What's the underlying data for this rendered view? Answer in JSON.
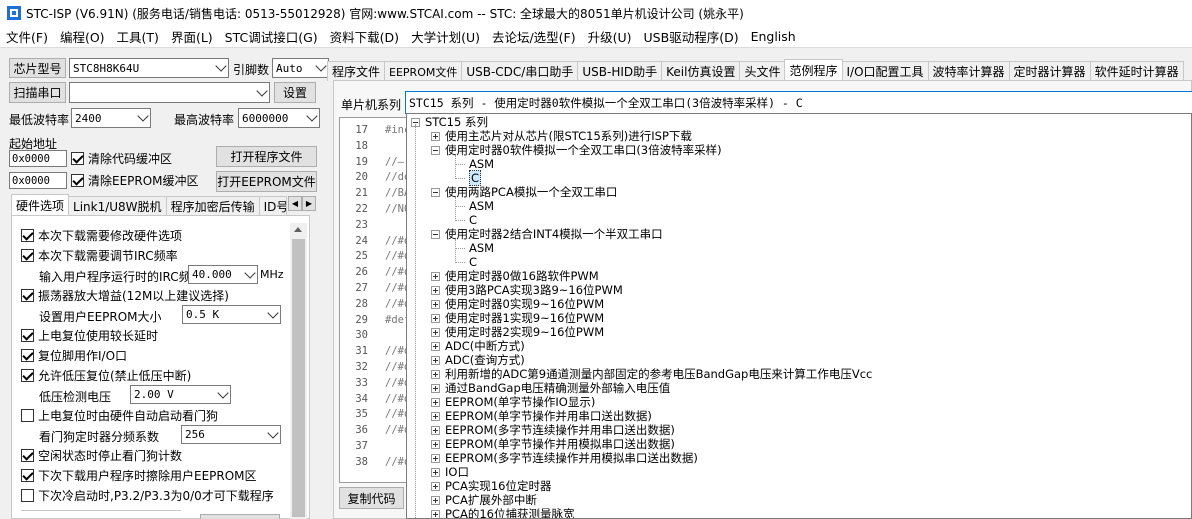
{
  "title": "STC-ISP (V6.91N) (服务电话/销售电话: 0513-55012928) 官网:www.STCAI.com  -- STC: 全球最大的8051单片机设计公司 (姚永平)",
  "menu": [
    "文件(F)",
    "编程(O)",
    "工具(T)",
    "界面(L)",
    "STC调试接口(G)",
    "资料下载(D)",
    "大学计划(U)",
    "去论坛/选型(F)",
    "升级(U)",
    "USB驱动程序(D)",
    "English"
  ],
  "left": {
    "chip_label": "芯片型号",
    "chip_value": "STC8H8K64U",
    "pins_label": "引脚数",
    "pins_value": "Auto",
    "scan_button": "扫描串口",
    "port_value": "",
    "settings_button": "设置",
    "min_baud_label": "最低波特率",
    "min_baud_value": "2400",
    "max_baud_label": "最高波特率",
    "max_baud_value": "6000000",
    "start_addr_label": "起始地址",
    "addr1": "0x0000",
    "clear_code": "清除代码缓冲区",
    "open_prog": "打开程序文件",
    "addr2": "0x0000",
    "clear_eeprom": "清除EEPROM缓冲区",
    "open_eeprom": "打开EEPROM文件",
    "tabs": [
      "硬件选项",
      "Link1/U8W脱机",
      "程序加密后传输",
      "ID号"
    ],
    "options": {
      "o1": "本次下载需要修改硬件选项",
      "o2": "本次下载需要调节IRC频率",
      "irc_label": "输入用户程序运行时的IRC频率",
      "irc_value": "40.000",
      "irc_unit": "MHz",
      "o3": "振荡器放大增益(12M以上建议选择)",
      "eeprom_label": "设置用户EEPROM大小",
      "eeprom_value": "0.5 K",
      "o4": "上电复位使用较长延时",
      "o5": "复位脚用作I/O口",
      "o6": "允许低压复位(禁止低压中断)",
      "lv_label": "低压检测电压",
      "lv_value": "2.00 V",
      "o7": "上电复位时由硬件自动启动看门狗",
      "wdt_label": "看门狗定时器分频系数",
      "wdt_value": "256",
      "o8": "空闲状态时停止看门狗计数",
      "o9": "下次下载用户程序时擦除用户EEPROM区",
      "o10": "下次冷启动时,P3.2/P3.3为0/0才可下载程序"
    }
  },
  "right": {
    "tabs": [
      "程序文件",
      "EEPROM文件",
      "USB-CDC/串口助手",
      "USB-HID助手",
      "Keil仿真设置",
      "头文件",
      "范例程序",
      "I/O口配置工具",
      "波特率计算器",
      "定时器计算器",
      "软件延时计算器"
    ],
    "series_label": "单片机系列",
    "series_value": "STC15 系列 - 使用定时器0软件模拟一个全双工串口(3倍波特率采样) - C",
    "copy_button": "复制代码",
    "code_lines": [
      {
        "n": "17",
        "t": "#inc"
      },
      {
        "n": "18",
        "t": ""
      },
      {
        "n": "19",
        "t": "//—"
      },
      {
        "n": "20",
        "t": "//de"
      },
      {
        "n": "21",
        "t": "//BA"
      },
      {
        "n": "22",
        "t": "//NO"
      },
      {
        "n": "23",
        "t": ""
      },
      {
        "n": "24",
        "t": "//#d"
      },
      {
        "n": "25",
        "t": "//#d"
      },
      {
        "n": "26",
        "t": "//#d"
      },
      {
        "n": "27",
        "t": "//#d"
      },
      {
        "n": "28",
        "t": "//#d"
      },
      {
        "n": "29",
        "t": "#def"
      },
      {
        "n": "30",
        "t": ""
      },
      {
        "n": "31",
        "t": "//#d"
      },
      {
        "n": "32",
        "t": "//#d"
      },
      {
        "n": "33",
        "t": "//#d"
      },
      {
        "n": "34",
        "t": "//#d"
      },
      {
        "n": "35",
        "t": "//#d"
      },
      {
        "n": "36",
        "t": "//#d"
      },
      {
        "n": "37",
        "t": ""
      },
      {
        "n": "38",
        "t": "//#d"
      }
    ],
    "tree": {
      "root": "STC15 系列",
      "items": [
        {
          "level": 1,
          "label": "使用主芯片对从芯片(限STC15系列)进行ISP下载",
          "exp": "plus"
        },
        {
          "level": 1,
          "label": "使用定时器0软件模拟一个全双工串口(3倍波特率采样)",
          "exp": "minus"
        },
        {
          "level": 2,
          "label": "ASM"
        },
        {
          "level": 2,
          "label": "C",
          "selected": true
        },
        {
          "level": 1,
          "label": "使用两路PCA模拟一个全双工串口",
          "exp": "minus"
        },
        {
          "level": 2,
          "label": "ASM"
        },
        {
          "level": 2,
          "label": "C"
        },
        {
          "level": 1,
          "label": "使用定时器2结合INT4模拟一个半双工串口",
          "exp": "minus"
        },
        {
          "level": 2,
          "label": "ASM"
        },
        {
          "level": 2,
          "label": "C"
        },
        {
          "level": 1,
          "label": "使用定时器0做16路软件PWM",
          "exp": "plus"
        },
        {
          "level": 1,
          "label": "使用3路PCA实现3路9~16位PWM",
          "exp": "plus"
        },
        {
          "level": 1,
          "label": "使用定时器0实现9~16位PWM",
          "exp": "plus"
        },
        {
          "level": 1,
          "label": "使用定时器1实现9~16位PWM",
          "exp": "plus"
        },
        {
          "level": 1,
          "label": "使用定时器2实现9~16位PWM",
          "exp": "plus"
        },
        {
          "level": 1,
          "label": "ADC(中断方式)",
          "exp": "plus"
        },
        {
          "level": 1,
          "label": "ADC(查询方式)",
          "exp": "plus"
        },
        {
          "level": 1,
          "label": "利用新增的ADC第9通道测量内部固定的参考电压BandGap电压来计算工作电压Vcc",
          "exp": "plus"
        },
        {
          "level": 1,
          "label": "通过BandGap电压精确测量外部输入电压值",
          "exp": "plus"
        },
        {
          "level": 1,
          "label": "EEPROM(单字节操作IO显示)",
          "exp": "plus"
        },
        {
          "level": 1,
          "label": "EEPROM(单字节操作并用串口送出数据)",
          "exp": "plus"
        },
        {
          "level": 1,
          "label": "EEPROM(多字节连续操作并用串口送出数据)",
          "exp": "plus"
        },
        {
          "level": 1,
          "label": "EEPROM(单字节操作并用模拟串口送出数据)",
          "exp": "plus"
        },
        {
          "level": 1,
          "label": "EEPROM(多字节连续操作并用模拟串口送出数据)",
          "exp": "plus"
        },
        {
          "level": 1,
          "label": "IO口",
          "exp": "plus"
        },
        {
          "level": 1,
          "label": "PCA实现16位定时器",
          "exp": "plus"
        },
        {
          "level": 1,
          "label": "PCA扩展外部中断",
          "exp": "plus"
        },
        {
          "level": 1,
          "label": "PCA的16位捕获测量脉宽",
          "exp": "plus"
        }
      ]
    }
  }
}
